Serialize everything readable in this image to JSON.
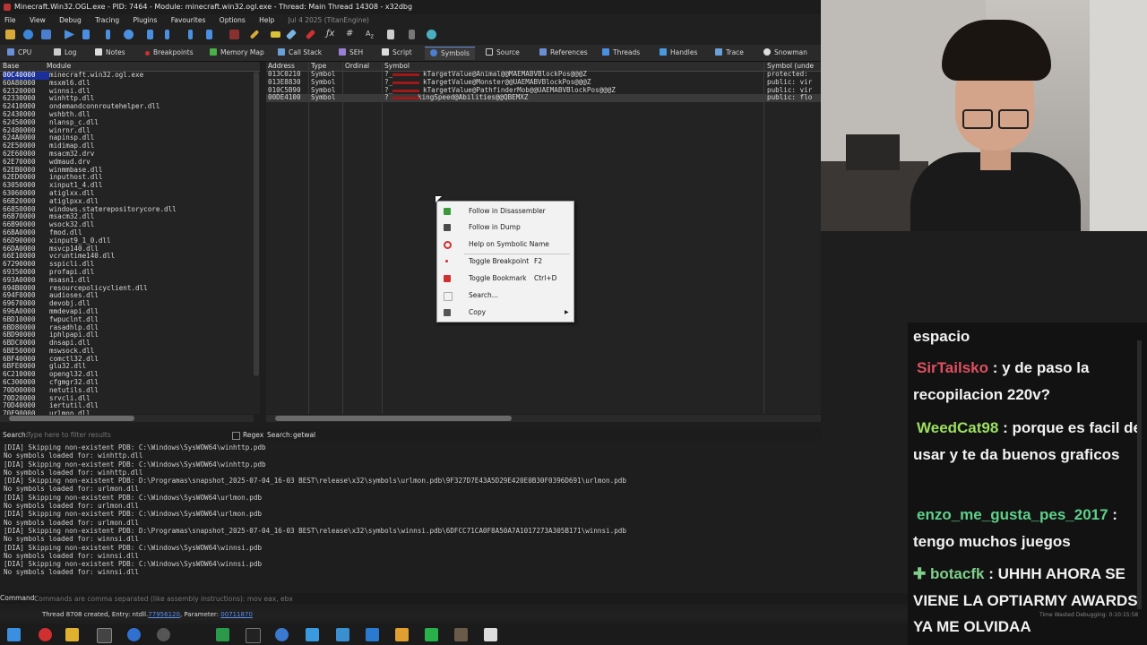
{
  "window": {
    "title": "Minecraft.Win32.OGL.exe - PID: 7464 - Module: minecraft.win32.ogl.exe - Thread: Main Thread 14308 - x32dbg"
  },
  "menu": {
    "items": [
      "File",
      "View",
      "Debug",
      "Tracing",
      "Plugins",
      "Favourites",
      "Options",
      "Help"
    ],
    "date": "Jul 4 2025 (TitanEngine)"
  },
  "tabs": [
    "CPU",
    "Log",
    "Notes",
    "Breakpoints",
    "Memory Map",
    "Call Stack",
    "SEH",
    "Script",
    "Symbols",
    "Source",
    "References",
    "Threads",
    "Handles",
    "Trace",
    "Snowman"
  ],
  "modules": {
    "headers": {
      "base": "Base",
      "module": "Module"
    },
    "rows": [
      {
        "base": "00C40000",
        "name": "minecraft.win32.ogl.exe"
      },
      {
        "base": "60A80000",
        "name": "msxml6.dll"
      },
      {
        "base": "62320000",
        "name": "winnsi.dll"
      },
      {
        "base": "62330000",
        "name": "winhttp.dll"
      },
      {
        "base": "62410000",
        "name": "ondemandconnroutehelper.dll"
      },
      {
        "base": "62430000",
        "name": "wshbth.dll"
      },
      {
        "base": "62450000",
        "name": "nlansp_c.dll"
      },
      {
        "base": "62480000",
        "name": "winrnr.dll"
      },
      {
        "base": "624A0000",
        "name": "napinsp.dll"
      },
      {
        "base": "62E50000",
        "name": "midimap.dll"
      },
      {
        "base": "62E60000",
        "name": "msacm32.drv"
      },
      {
        "base": "62E70000",
        "name": "wdmaud.drv"
      },
      {
        "base": "62EB0000",
        "name": "winmmbase.dll"
      },
      {
        "base": "62ED0000",
        "name": "inputhost.dll"
      },
      {
        "base": "63050000",
        "name": "xinput1_4.dll"
      },
      {
        "base": "63060000",
        "name": "atiglxx.dll"
      },
      {
        "base": "66B20000",
        "name": "atiglpxx.dll"
      },
      {
        "base": "66850000",
        "name": "windows.staterepositorycore.dll"
      },
      {
        "base": "66B70000",
        "name": "msacm32.dll"
      },
      {
        "base": "66B90000",
        "name": "wsock32.dll"
      },
      {
        "base": "66BA0000",
        "name": "fmod.dll"
      },
      {
        "base": "66D90000",
        "name": "xinput9_1_0.dll"
      },
      {
        "base": "66DA0000",
        "name": "msvcp140.dll"
      },
      {
        "base": "66E10000",
        "name": "vcruntime140.dll"
      },
      {
        "base": "67290000",
        "name": "sspicli.dll"
      },
      {
        "base": "69350000",
        "name": "profapi.dll"
      },
      {
        "base": "693A0000",
        "name": "msasn1.dll"
      },
      {
        "base": "694B0000",
        "name": "resourcepolicyclient.dll"
      },
      {
        "base": "694F0000",
        "name": "audioses.dll"
      },
      {
        "base": "69670000",
        "name": "devobj.dll"
      },
      {
        "base": "696A0000",
        "name": "mmdevapi.dll"
      },
      {
        "base": "6BD10000",
        "name": "fwpuclnt.dll"
      },
      {
        "base": "6BD80000",
        "name": "rasadhlp.dll"
      },
      {
        "base": "6BD90000",
        "name": "iphlpapi.dll"
      },
      {
        "base": "6BDC0000",
        "name": "dnsapi.dll"
      },
      {
        "base": "6BE50000",
        "name": "mswsock.dll"
      },
      {
        "base": "6BF40000",
        "name": "comctl32.dll"
      },
      {
        "base": "6BFE0000",
        "name": "glu32.dll"
      },
      {
        "base": "6C210000",
        "name": "opengl32.dll"
      },
      {
        "base": "6C300000",
        "name": "cfgmgr32.dll"
      },
      {
        "base": "70D00000",
        "name": "netutils.dll"
      },
      {
        "base": "70D20000",
        "name": "srvcli.dll"
      },
      {
        "base": "70D40000",
        "name": "iertutil.dll"
      },
      {
        "base": "70F90000",
        "name": "urlmon.dll"
      }
    ]
  },
  "symbols": {
    "headers": {
      "address": "Address",
      "type": "Type",
      "ordinal": "Ordinal",
      "symbol": "Symbol",
      "undecorated": "Symbol (unde"
    },
    "rows": [
      {
        "address": "013C0210",
        "type": "Symbol",
        "prefix": "?_",
        "symbol": "kTargetValue@Animal@@MAEMABVBlockPos@@@Z",
        "undecorated": "protected:"
      },
      {
        "address": "013E8830",
        "type": "Symbol",
        "prefix": "?_",
        "symbol": "kTargetValue@Monster@@UAEMABVBlockPos@@@Z",
        "undecorated": "public: vir"
      },
      {
        "address": "010C5B90",
        "type": "Symbol",
        "prefix": "?_",
        "symbol": "kTargetValue@PathfinderMob@@UAEMABVBlockPos@@@Z",
        "undecorated": "public: vir"
      },
      {
        "address": "00DE4100",
        "type": "Symbol",
        "prefix": "?",
        "symbol": "kingSpeed@Abilities@@QBEMXZ",
        "undecorated": "public: flo"
      }
    ]
  },
  "search": {
    "left_label": "Search:",
    "left_placeholder": "Type here to filter results",
    "right_label": "Search:",
    "right_value": "getwal",
    "regex_label": "Regex"
  },
  "context_menu": {
    "items": [
      {
        "label": "Follow in Disassembler",
        "shortcut": ""
      },
      {
        "label": "Follow in Dump",
        "shortcut": ""
      },
      {
        "label": "Help on Symbolic Name",
        "shortcut": ""
      },
      {
        "label": "Toggle Breakpoint",
        "shortcut": "F2"
      },
      {
        "label": "Toggle Bookmark",
        "shortcut": "Ctrl+D"
      },
      {
        "label": "Search...",
        "shortcut": ""
      },
      {
        "label": "Copy",
        "shortcut": ""
      }
    ]
  },
  "log": {
    "lines": [
      "[DIA] Skipping non-existent PDB: C:\\Windows\\SysWOW64\\winhttp.pdb",
      "No symbols loaded for: winhttp.dll",
      "[DIA] Skipping non-existent PDB: C:\\Windows\\SysWOW64\\winhttp.pdb",
      "No symbols loaded for: winhttp.dll",
      "[DIA] Skipping non-existent PDB: D:\\Programas\\snapshot_2025-07-04_16-03 BEST\\release\\x32\\symbols\\urlmon.pdb\\9F327D7E43A5D29E420E0B30F0396D691\\urlmon.pdb",
      "No symbols loaded for: urlmon.dll",
      "[DIA] Skipping non-existent PDB: C:\\Windows\\SysWOW64\\urlmon.pdb",
      "No symbols loaded for: urlmon.dll",
      "[DIA] Skipping non-existent PDB: C:\\Windows\\SysWOW64\\urlmon.pdb",
      "No symbols loaded for: urlmon.dll",
      "[DIA] Skipping non-existent PDB: D:\\Programas\\snapshot_2025-07-04_16-03 BEST\\release\\x32\\symbols\\winnsi.pdb\\6DFCC71CA0F8A50A7A1017273A305B171\\winnsi.pdb",
      "No symbols loaded for: winnsi.dll",
      "[DIA] Skipping non-existent PDB: C:\\Windows\\SysWOW64\\winnsi.pdb",
      "No symbols loaded for: winnsi.dll",
      "[DIA] Skipping non-existent PDB: C:\\Windows\\SysWOW64\\winnsi.pdb",
      "No symbols loaded for: winnsi.dll"
    ]
  },
  "command": {
    "label": "Command:",
    "placeholder": "Commands are comma separated (like assembly instructions): mov eax, ebx"
  },
  "status": {
    "thread_text": "Thread 8708 created, Entry: ntdll.",
    "entry_link": "77956120",
    "param_text": ", Parameter: ",
    "param_link": "00711870",
    "time_wasted": "Time Wasted Debugging: 0:10:15:58"
  },
  "chat": {
    "messages": [
      {
        "user": "",
        "user_color": "",
        "text": "espacio"
      },
      {
        "user": "SirTailsko",
        "user_color": "#e05060",
        "text": ": y de paso la recopilacion 220v?"
      },
      {
        "user": "WeedCat98",
        "user_color": "#9be060",
        "text": ": porque es facil de usar y te da buenos graficos"
      },
      {
        "user": "enzo_me_gusta_pes_2017",
        "user_color": "#5fd08a",
        "text": ": tengo muchos juegos"
      },
      {
        "user": "botacfk",
        "user_color": "#7fcf8a",
        "text": ": UHHH AHORA SE VIENE LA OPTIARMY AWARDS YA ME OLVIDAA"
      }
    ]
  },
  "colors": {
    "selected_row": "#1a2f99",
    "link": "#5a8ff0",
    "accent": "#6a8fd8"
  }
}
